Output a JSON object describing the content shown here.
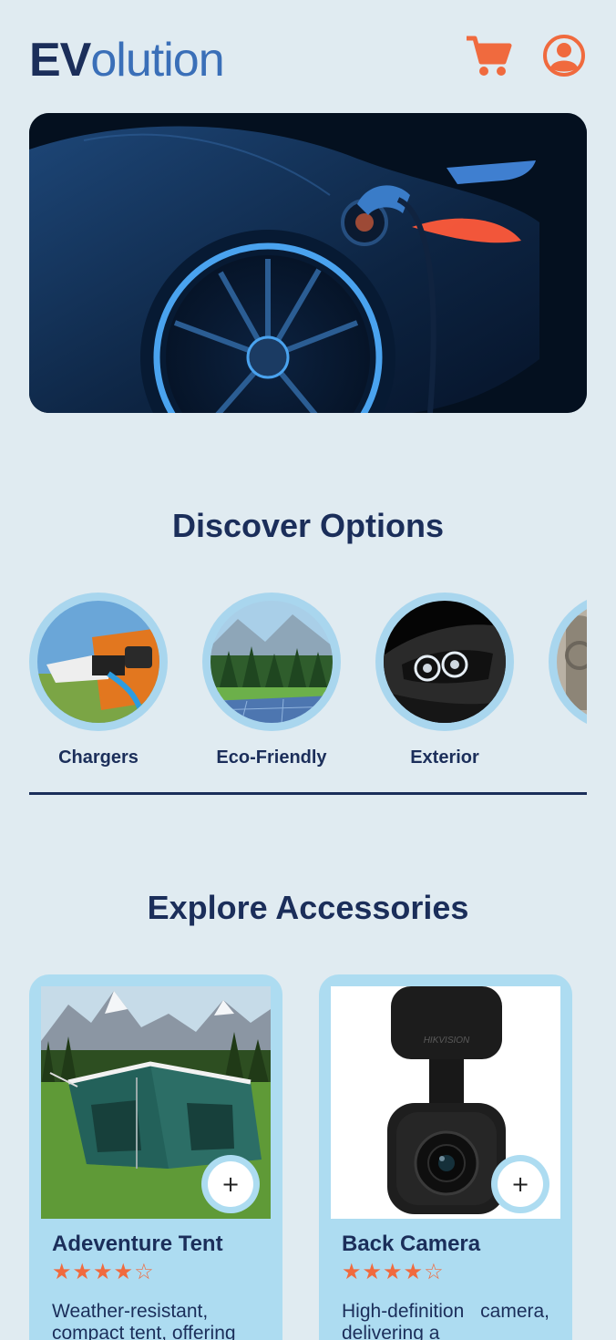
{
  "header": {
    "logo_ev": "EV",
    "logo_rest": "olution",
    "cart_icon": "shopping-cart-icon",
    "profile_icon": "user-profile-icon",
    "accent_color": "#f06a3e"
  },
  "hero": {
    "image": "electric-car-charging"
  },
  "discover": {
    "title": "Discover Options",
    "categories": [
      {
        "label": "Chargers",
        "image": "ev-charger-plug"
      },
      {
        "label": "Eco-Friendly",
        "image": "forest-solar-panel"
      },
      {
        "label": "Exterior",
        "image": "car-headlight"
      },
      {
        "label": "",
        "image": "car-interior"
      }
    ]
  },
  "explore": {
    "title": "Explore Accessories",
    "products": [
      {
        "name": "Adeventure Tent",
        "rating": 4,
        "rating_max": 5,
        "stars": "★★★★☆",
        "description": "Weather-resistant, compact tent, offering",
        "add_label": "+",
        "image": "camping-tent"
      },
      {
        "name": "Back Camera",
        "rating": 4,
        "rating_max": 5,
        "stars": "★★★★☆",
        "description": "High-definition camera, delivering a",
        "add_label": "+",
        "image": "dash-camera",
        "image_brand": "HIKVISION"
      }
    ]
  }
}
